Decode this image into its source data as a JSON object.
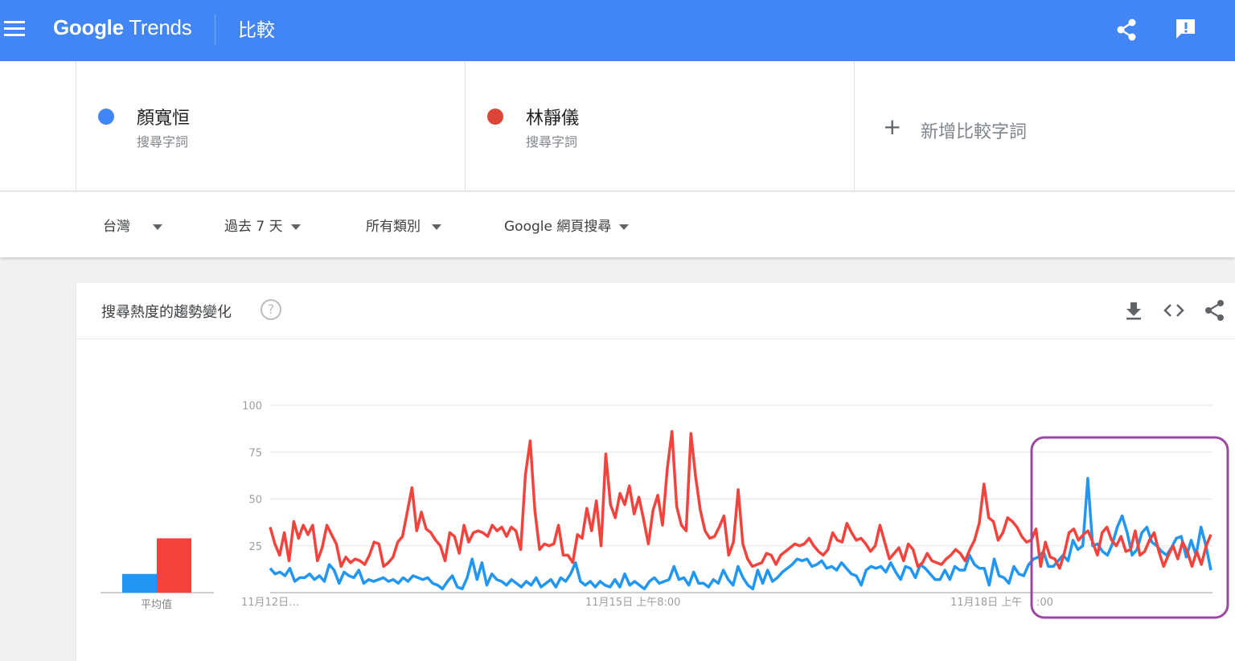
{
  "appbar": {
    "logo_google": "Google",
    "logo_trends": "Trends",
    "title": "比較",
    "icons": [
      "menu-icon",
      "share-icon",
      "feedback-icon"
    ]
  },
  "terms": [
    {
      "name": "顏寬恒",
      "sub": "搜尋字詞",
      "color": "#4285f4"
    },
    {
      "name": "林靜儀",
      "sub": "搜尋字詞",
      "color": "#db4437"
    }
  ],
  "add_term": {
    "label": "新增比較字詞"
  },
  "filters": {
    "region": "台灣",
    "time": "過去 7 天",
    "category": "所有類別",
    "search_type": "Google 網頁搜尋"
  },
  "card": {
    "title": "搜尋熱度的趨勢變化",
    "help": "?",
    "avg_label": "平均值"
  },
  "colors": {
    "blue": "#2196f3",
    "red": "#f4433c",
    "highlight": "#9c47a3"
  },
  "chart_data": {
    "type": "line",
    "yticks": [
      "100",
      "75",
      "50",
      "25"
    ],
    "ylim": [
      0,
      100
    ],
    "xticks": [
      "11月12日…",
      "11月15日 上午8:00",
      "11月18日 上午",
      ":00"
    ],
    "averages": [
      {
        "name": "顏寬恒",
        "value": 10
      },
      {
        "name": "林靜儀",
        "value": 29
      }
    ],
    "series": [
      {
        "name": "顏寬恒",
        "values": [
          13,
          10,
          11,
          9,
          13,
          6,
          8,
          8,
          10,
          7,
          9,
          6,
          15,
          12,
          5,
          11,
          9,
          8,
          12,
          5,
          7,
          6,
          7,
          8,
          6,
          7,
          5,
          8,
          6,
          9,
          8,
          7,
          8,
          5,
          4,
          2,
          6,
          9,
          3,
          2,
          8,
          18,
          7,
          16,
          4,
          10,
          7,
          6,
          4,
          7,
          5,
          3,
          6,
          4,
          8,
          3,
          5,
          7,
          3,
          8,
          6,
          10,
          16,
          6,
          4,
          6,
          3,
          6,
          4,
          3,
          7,
          3,
          10,
          4,
          6,
          4,
          2,
          6,
          8,
          5,
          6,
          7,
          14,
          7,
          8,
          4,
          11,
          5,
          5,
          3,
          7,
          5,
          12,
          7,
          4,
          14,
          8,
          4,
          2,
          12,
          5,
          12,
          6,
          8,
          11,
          13,
          15,
          18,
          17,
          18,
          14,
          15,
          17,
          13,
          14,
          12,
          16,
          13,
          10,
          9,
          4,
          12,
          14,
          13,
          14,
          11,
          16,
          11,
          7,
          14,
          13,
          8,
          15,
          13,
          10,
          7,
          7,
          12,
          7,
          14,
          12,
          12,
          20,
          15,
          13,
          13,
          4,
          18,
          9,
          8,
          5,
          14,
          10,
          9,
          15,
          18,
          19,
          22,
          14,
          14,
          17,
          20,
          17,
          28,
          23,
          25,
          61,
          25,
          26,
          22,
          20,
          26,
          35,
          41,
          32,
          20,
          23,
          32,
          35,
          27,
          25,
          22,
          20,
          24,
          29,
          30,
          19,
          28,
          20,
          35,
          25,
          12
        ]
      },
      {
        "name": "林靜儀",
        "values": [
          35,
          26,
          20,
          32,
          17,
          38,
          29,
          36,
          31,
          36,
          17,
          24,
          36,
          31,
          26,
          14,
          19,
          16,
          18,
          17,
          15,
          20,
          27,
          26,
          14,
          16,
          19,
          27,
          30,
          43,
          56,
          33,
          43,
          34,
          32,
          28,
          25,
          17,
          32,
          30,
          21,
          36,
          27,
          32,
          33,
          32,
          30,
          36,
          33,
          35,
          30,
          35,
          33,
          23,
          63,
          81,
          44,
          23,
          26,
          25,
          26,
          36,
          20,
          20,
          16,
          31,
          29,
          45,
          33,
          49,
          25,
          74,
          47,
          40,
          53,
          47,
          57,
          42,
          51,
          39,
          26,
          44,
          52,
          36,
          66,
          86,
          46,
          36,
          33,
          85,
          62,
          44,
          33,
          29,
          30,
          35,
          41,
          20,
          27,
          55,
          26,
          18,
          14,
          15,
          16,
          21,
          20,
          15,
          20,
          22,
          24,
          26,
          25,
          26,
          29,
          25,
          22,
          20,
          23,
          32,
          28,
          27,
          37,
          32,
          28,
          29,
          26,
          22,
          25,
          36,
          27,
          18,
          21,
          24,
          17,
          26,
          23,
          14,
          16,
          21,
          17,
          16,
          15,
          18,
          20,
          23,
          21,
          17,
          23,
          28,
          37,
          58,
          40,
          38,
          28,
          32,
          40,
          38,
          35,
          30,
          27,
          28,
          34,
          14,
          27,
          19,
          18,
          13,
          21,
          32,
          34,
          28,
          31,
          33,
          27,
          20,
          32,
          35,
          28,
          25,
          30,
          22,
          23,
          33,
          20,
          22,
          28,
          32,
          22,
          14,
          20,
          25,
          18,
          27,
          22,
          14,
          22,
          15,
          25,
          31
        ]
      }
    ]
  }
}
